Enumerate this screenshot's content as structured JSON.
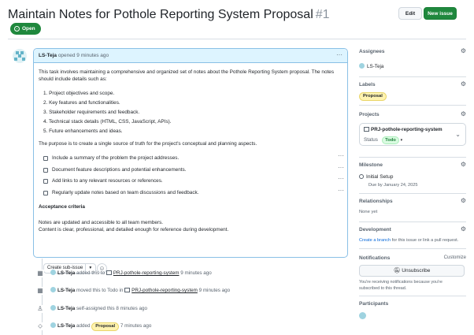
{
  "issue": {
    "title": "Maintain Notes for Pothole Reporting System Proposal",
    "number": "#1",
    "status": "Open",
    "edit_label": "Edit",
    "new_issue_label": "New issue"
  },
  "comment": {
    "author": "LS-Teja",
    "meta": "opened 9 minutes ago",
    "intro": "This task involves maintaining a comprehensive and organized set of notes about the Pothole Reporting System proposal. The notes should include details such as:",
    "list": [
      "1. Project objectives and scope.",
      "2. Key features and functionalities.",
      "3. Stakeholder requirements and feedback.",
      "4. Technical stack details (HTML, CSS, JavaScript, APIs).",
      "5. Future enhancements and ideas."
    ],
    "purpose": "The purpose is to create a single source of truth for the project's conceptual and planning aspects.",
    "tasks": [
      "Include a summary of the problem the project addresses.",
      "Document feature descriptions and potential enhancements.",
      "Add links to any relevant resources or references.",
      "Regularly update notes based on team discussions and feedback."
    ],
    "acceptance_heading": "Acceptance criteria",
    "acceptance": [
      "Notes are updated and accessible to all team members.",
      "Content is clear, professional, and detailed enough for reference during development."
    ],
    "create_sub_issue_label": "Create sub-issue"
  },
  "timeline": [
    {
      "icon": "table-icon",
      "author": "LS-Teja",
      "pre": "added this to",
      "link": "PRJ-pothole-reporting-system",
      "post": "9 minutes ago"
    },
    {
      "icon": "table-icon",
      "author": "LS-Teja",
      "pre": "moved this to Todo in",
      "link": "PRJ-pothole-reporting-system",
      "post": "9 minutes ago"
    },
    {
      "icon": "person-icon",
      "author": "LS-Teja",
      "pre": "self-assigned this 8 minutes ago",
      "link": "",
      "post": ""
    },
    {
      "icon": "tag-icon",
      "author": "LS-Teja",
      "pre": "added",
      "label": "Proposal",
      "post": "7 minutes ago"
    }
  ],
  "sidebar": {
    "assignees": {
      "heading": "Assignees",
      "value": "LS-Teja"
    },
    "labels": {
      "heading": "Labels",
      "value": "Proposal"
    },
    "projects": {
      "heading": "Projects",
      "name": "PRJ-pothole-reporting-system",
      "status_label": "Status",
      "status_value": "Todo"
    },
    "milestone": {
      "heading": "Milestone",
      "name": "Initial Setup",
      "due": "Due by January 24, 2025"
    },
    "relationships": {
      "heading": "Relationships",
      "value": "None yet"
    },
    "development": {
      "heading": "Development",
      "link": "Create a branch",
      "rest": "for this issue or link a pull request."
    },
    "notifications": {
      "heading": "Notifications",
      "customize": "Customize",
      "button": "Unsubscribe",
      "note": "You're receiving notifications because you're subscribed to this thread."
    },
    "participants": {
      "heading": "Participants"
    }
  },
  "colors": {
    "open_green": "#1f883d",
    "link_blue": "#0969da",
    "proposal_yellow": "#fff3b0",
    "todo_green": "#dafbe1"
  }
}
